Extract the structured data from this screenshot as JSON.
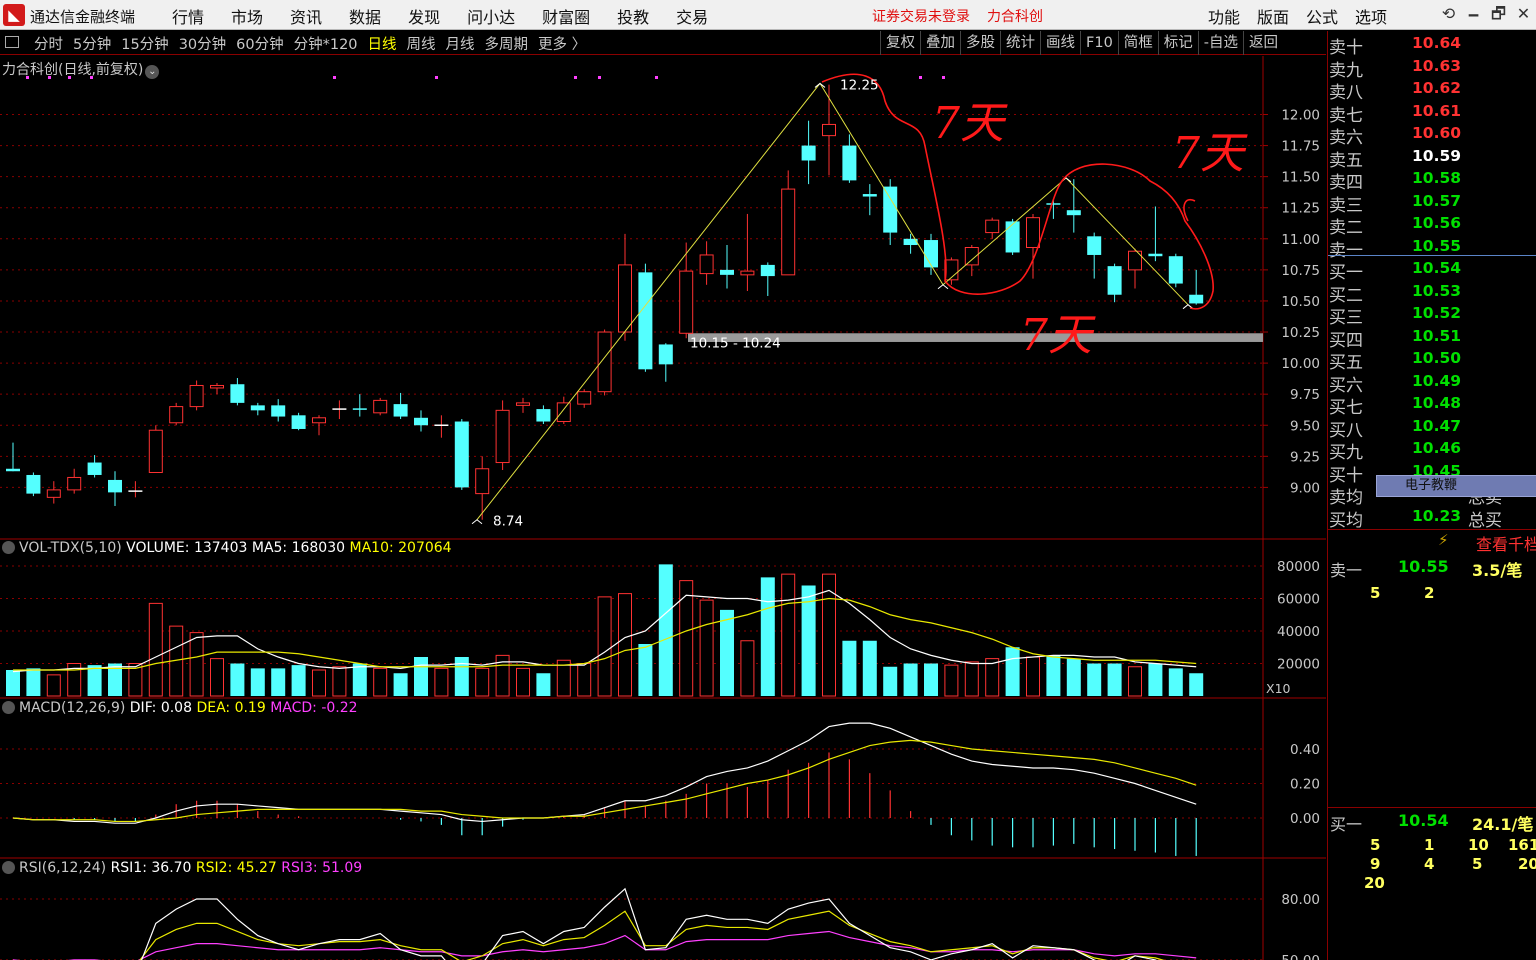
{
  "app": {
    "title": "通达信金融终端",
    "menu": [
      "行情",
      "市场",
      "资讯",
      "数据",
      "发现",
      "问小达",
      "财富圈",
      "投教",
      "交易"
    ],
    "status_text": "证券交易未登录",
    "stock_name": "力合科创",
    "right_menu": [
      "功能",
      "版面",
      "公式",
      "选项"
    ],
    "window_controls": [
      "⟲",
      "🗕",
      "🗗",
      "✕"
    ]
  },
  "toolbar": {
    "periods": [
      "分时",
      "5分钟",
      "15分钟",
      "30分钟",
      "60分钟",
      "分钟*120",
      "日线",
      "周线",
      "月线",
      "多周期",
      "更多 〉"
    ],
    "active_period": "日线",
    "tools": [
      "复权",
      "叠加",
      "多股",
      "统计",
      "画线",
      "F10",
      "简框",
      "标记",
      "-自选",
      "返回"
    ]
  },
  "main_chart": {
    "caption": "力合科创(日线,前复权)",
    "y_ticks": [
      "12.00",
      "11.75",
      "11.50",
      "11.25",
      "11.00",
      "10.75",
      "10.50",
      "10.25",
      "10.00",
      "9.75",
      "9.50",
      "9.25",
      "9.00"
    ],
    "low_label": "8.74",
    "high_label": "12.25",
    "range_label": "10.15 - 10.24",
    "annotations": [
      "7天",
      "7天",
      "7天"
    ],
    "colors": {
      "up": "#ff3232",
      "down": "#54ffff",
      "ma": "#ffff00",
      "grid": "#8a0000",
      "draw_line": "#e0e040",
      "hand_drawn": "#ff1a1a",
      "support_band": "#9a9a9a"
    }
  },
  "candles": [
    {
      "o": 9.15,
      "c": 9.13,
      "h": 9.36,
      "l": 9.13
    },
    {
      "o": 9.1,
      "c": 8.95,
      "h": 9.12,
      "l": 8.93
    },
    {
      "o": 8.92,
      "c": 8.98,
      "h": 9.05,
      "l": 8.87
    },
    {
      "o": 8.98,
      "c": 9.08,
      "h": 9.15,
      "l": 8.95
    },
    {
      "o": 9.2,
      "c": 9.1,
      "h": 9.26,
      "l": 9.08
    },
    {
      "o": 9.06,
      "c": 8.96,
      "h": 9.13,
      "l": 8.85
    },
    {
      "o": 8.96,
      "c": 8.97,
      "h": 9.05,
      "l": 8.92
    },
    {
      "o": 9.12,
      "c": 9.46,
      "h": 9.5,
      "l": 9.12
    },
    {
      "o": 9.52,
      "c": 9.65,
      "h": 9.68,
      "l": 9.5
    },
    {
      "o": 9.65,
      "c": 9.82,
      "h": 9.86,
      "l": 9.62
    },
    {
      "o": 9.8,
      "c": 9.82,
      "h": 9.84,
      "l": 9.75
    },
    {
      "o": 9.83,
      "c": 9.68,
      "h": 9.88,
      "l": 9.66
    },
    {
      "o": 9.66,
      "c": 9.62,
      "h": 9.68,
      "l": 9.58
    },
    {
      "o": 9.66,
      "c": 9.57,
      "h": 9.71,
      "l": 9.53
    },
    {
      "o": 9.58,
      "c": 9.47,
      "h": 9.6,
      "l": 9.46
    },
    {
      "o": 9.52,
      "c": 9.56,
      "h": 9.58,
      "l": 9.42
    },
    {
      "o": 9.63,
      "c": 9.63,
      "h": 9.7,
      "l": 9.55
    },
    {
      "o": 9.63,
      "c": 9.62,
      "h": 9.75,
      "l": 9.57
    },
    {
      "o": 9.6,
      "c": 9.7,
      "h": 9.72,
      "l": 9.58
    },
    {
      "o": 9.67,
      "c": 9.57,
      "h": 9.76,
      "l": 9.55
    },
    {
      "o": 9.56,
      "c": 9.5,
      "h": 9.62,
      "l": 9.45
    },
    {
      "o": 9.49,
      "c": 9.5,
      "h": 9.58,
      "l": 9.4
    },
    {
      "o": 9.53,
      "c": 9.0,
      "h": 9.55,
      "l": 8.98
    },
    {
      "o": 8.95,
      "c": 9.15,
      "h": 9.25,
      "l": 8.74
    },
    {
      "o": 9.2,
      "c": 9.62,
      "h": 9.7,
      "l": 9.14
    },
    {
      "o": 9.66,
      "c": 9.68,
      "h": 9.72,
      "l": 9.6
    },
    {
      "o": 9.63,
      "c": 9.53,
      "h": 9.66,
      "l": 9.51
    },
    {
      "o": 9.53,
      "c": 9.68,
      "h": 9.73,
      "l": 9.51
    },
    {
      "o": 9.67,
      "c": 9.77,
      "h": 9.79,
      "l": 9.64
    },
    {
      "o": 9.77,
      "c": 10.25,
      "h": 10.27,
      "l": 9.74
    },
    {
      "o": 10.25,
      "c": 10.79,
      "h": 11.04,
      "l": 10.18
    },
    {
      "o": 10.73,
      "c": 9.95,
      "h": 10.8,
      "l": 9.93
    },
    {
      "o": 10.15,
      "c": 9.99,
      "h": 10.16,
      "l": 9.85
    },
    {
      "o": 10.24,
      "c": 10.74,
      "h": 10.97,
      "l": 10.2
    },
    {
      "o": 10.72,
      "c": 10.87,
      "h": 10.98,
      "l": 10.63
    },
    {
      "o": 10.75,
      "c": 10.71,
      "h": 10.95,
      "l": 10.6
    },
    {
      "o": 10.71,
      "c": 10.74,
      "h": 11.2,
      "l": 10.58
    },
    {
      "o": 10.79,
      "c": 10.7,
      "h": 10.81,
      "l": 10.54
    },
    {
      "o": 10.71,
      "c": 11.4,
      "h": 11.55,
      "l": 10.71
    },
    {
      "o": 11.75,
      "c": 11.63,
      "h": 11.95,
      "l": 11.44
    },
    {
      "o": 11.83,
      "c": 11.92,
      "h": 12.24,
      "l": 11.51
    },
    {
      "o": 11.75,
      "c": 11.47,
      "h": 11.84,
      "l": 11.45
    },
    {
      "o": 11.36,
      "c": 11.34,
      "h": 11.44,
      "l": 11.19
    },
    {
      "o": 11.42,
      "c": 11.05,
      "h": 11.48,
      "l": 10.95
    },
    {
      "o": 11.0,
      "c": 10.95,
      "h": 11.04,
      "l": 10.88
    },
    {
      "o": 10.99,
      "c": 10.77,
      "h": 11.04,
      "l": 10.71
    },
    {
      "o": 10.67,
      "c": 10.83,
      "h": 10.85,
      "l": 10.63
    },
    {
      "o": 10.79,
      "c": 10.93,
      "h": 10.95,
      "l": 10.7
    },
    {
      "o": 11.05,
      "c": 11.15,
      "h": 11.17,
      "l": 11.0
    },
    {
      "o": 11.14,
      "c": 10.89,
      "h": 11.16,
      "l": 10.87
    },
    {
      "o": 10.93,
      "c": 11.17,
      "h": 11.2,
      "l": 10.68
    },
    {
      "o": 11.28,
      "c": 11.27,
      "h": 11.32,
      "l": 11.16
    },
    {
      "o": 11.23,
      "c": 11.19,
      "h": 11.48,
      "l": 11.05
    },
    {
      "o": 11.02,
      "c": 10.87,
      "h": 11.05,
      "l": 10.68
    },
    {
      "o": 10.78,
      "c": 10.55,
      "h": 10.8,
      "l": 10.49
    },
    {
      "o": 10.75,
      "c": 10.9,
      "h": 10.92,
      "l": 10.6
    },
    {
      "o": 10.88,
      "c": 10.86,
      "h": 11.26,
      "l": 10.82
    },
    {
      "o": 10.86,
      "c": 10.64,
      "h": 10.88,
      "l": 10.61
    },
    {
      "o": 10.55,
      "c": 10.48,
      "h": 10.75,
      "l": 10.47
    }
  ],
  "volume": {
    "label": "VOL-TDX(5,10)",
    "text_vol": "VOLUME: 137403",
    "text_ma5": "MA5: 168030",
    "text_ma10": "MA10: 207064",
    "y_ticks": [
      "80000",
      "60000",
      "40000",
      "20000"
    ],
    "unit": "X10",
    "values": [
      16000,
      17000,
      13000,
      20000,
      19000,
      20000,
      20000,
      57000,
      43000,
      39000,
      23000,
      20000,
      17000,
      17000,
      19000,
      16000,
      18000,
      20000,
      17000,
      14000,
      24000,
      17000,
      24000,
      17000,
      25000,
      17000,
      14000,
      22000,
      20000,
      61000,
      63000,
      32000,
      81000,
      71000,
      59000,
      53000,
      34000,
      73000,
      75000,
      68000,
      75000,
      34000,
      34000,
      18000,
      20000,
      20000,
      19000,
      21000,
      23000,
      30000,
      24000,
      25000,
      23000,
      20000,
      20000,
      18000,
      20000,
      17000,
      14000
    ],
    "ma5": [
      15000,
      16000,
      16000,
      17000,
      17000,
      18000,
      18000,
      24000,
      30000,
      36000,
      37000,
      37000,
      29000,
      24000,
      20000,
      18000,
      17000,
      18000,
      18000,
      17000,
      19000,
      19000,
      20000,
      19000,
      21000,
      21000,
      19000,
      19000,
      19000,
      27000,
      36000,
      40000,
      51000,
      62000,
      61000,
      60000,
      60000,
      58000,
      59000,
      61000,
      65000,
      57000,
      47000,
      36000,
      29000,
      25000,
      22000,
      20000,
      20000,
      23000,
      24000,
      25000,
      25000,
      24000,
      24000,
      21000,
      20000,
      19000,
      18000
    ],
    "ma10": [
      16000,
      16000,
      16000,
      16000,
      17000,
      17000,
      17000,
      20000,
      22000,
      24000,
      27000,
      27000,
      27000,
      27000,
      26000,
      24000,
      22000,
      20000,
      18000,
      18000,
      18000,
      18000,
      18000,
      18000,
      19000,
      19000,
      19000,
      19000,
      20000,
      23000,
      28000,
      30000,
      35000,
      40000,
      44000,
      47000,
      50000,
      54000,
      57000,
      58000,
      60000,
      59000,
      55000,
      50000,
      47000,
      45000,
      42000,
      39000,
      35000,
      30000,
      26000,
      24000,
      23000,
      22000,
      22000,
      22000,
      22000,
      21000,
      20000
    ]
  },
  "macd": {
    "label": "MACD(12,26,9)",
    "text_dif": "DIF: 0.08",
    "text_dea": "DEA: 0.19",
    "text_macd": "MACD: -0.22",
    "y_ticks": [
      "0.40",
      "0.20",
      "0.00"
    ],
    "dif": [
      0.0,
      -0.01,
      -0.01,
      -0.02,
      -0.02,
      -0.03,
      -0.03,
      0.0,
      0.04,
      0.07,
      0.08,
      0.08,
      0.07,
      0.06,
      0.05,
      0.05,
      0.05,
      0.05,
      0.05,
      0.04,
      0.03,
      0.02,
      -0.01,
      -0.02,
      -0.01,
      0.0,
      0.0,
      0.01,
      0.02,
      0.06,
      0.1,
      0.1,
      0.13,
      0.18,
      0.24,
      0.27,
      0.29,
      0.33,
      0.39,
      0.45,
      0.53,
      0.55,
      0.55,
      0.52,
      0.47,
      0.42,
      0.37,
      0.33,
      0.31,
      0.3,
      0.29,
      0.29,
      0.28,
      0.26,
      0.23,
      0.2,
      0.16,
      0.12,
      0.08
    ],
    "dea": [
      0.0,
      -0.01,
      -0.01,
      -0.01,
      -0.01,
      -0.02,
      -0.02,
      -0.01,
      0.0,
      0.02,
      0.03,
      0.04,
      0.05,
      0.05,
      0.05,
      0.05,
      0.05,
      0.05,
      0.05,
      0.05,
      0.04,
      0.04,
      0.02,
      0.01,
      0.0,
      0.0,
      0.0,
      0.01,
      0.01,
      0.03,
      0.05,
      0.07,
      0.09,
      0.11,
      0.14,
      0.17,
      0.2,
      0.22,
      0.25,
      0.29,
      0.34,
      0.38,
      0.42,
      0.44,
      0.45,
      0.44,
      0.42,
      0.4,
      0.39,
      0.38,
      0.37,
      0.36,
      0.35,
      0.34,
      0.32,
      0.29,
      0.26,
      0.23,
      0.19
    ],
    "hist": [
      0.0,
      0.0,
      0.0,
      -0.01,
      -0.01,
      -0.02,
      -0.02,
      0.02,
      0.08,
      0.1,
      0.1,
      0.08,
      0.04,
      0.02,
      0.01,
      0.0,
      0.0,
      0.0,
      0.0,
      -0.01,
      -0.02,
      -0.04,
      -0.1,
      -0.1,
      -0.05,
      -0.01,
      0.0,
      0.01,
      0.02,
      0.06,
      0.1,
      0.07,
      0.1,
      0.14,
      0.2,
      0.2,
      0.18,
      0.22,
      0.28,
      0.32,
      0.38,
      0.34,
      0.26,
      0.16,
      0.04,
      -0.04,
      -0.1,
      -0.13,
      -0.16,
      -0.17,
      -0.17,
      -0.16,
      -0.15,
      -0.17,
      -0.18,
      -0.19,
      -0.2,
      -0.22,
      -0.22
    ]
  },
  "rsi": {
    "label": "RSI(6,12,24)",
    "text_rsi1": "RSI1: 36.70",
    "text_rsi2": "RSI2: 45.27",
    "text_rsi3": "RSI3: 51.09",
    "y_ticks": [
      "80.00",
      "50.00"
    ],
    "rsi1": [
      45,
      38,
      40,
      46,
      48,
      42,
      42,
      68,
      75,
      80,
      80,
      70,
      62,
      58,
      55,
      58,
      60,
      60,
      63,
      55,
      52,
      52,
      40,
      48,
      62,
      64,
      58,
      64,
      66,
      76,
      85,
      55,
      56,
      70,
      72,
      70,
      70,
      68,
      75,
      78,
      80,
      68,
      62,
      56,
      54,
      50,
      53,
      55,
      58,
      51,
      57,
      56,
      55,
      50,
      46,
      52,
      50,
      45,
      37
    ],
    "rsi2": [
      48,
      45,
      46,
      48,
      49,
      47,
      47,
      60,
      65,
      68,
      68,
      64,
      60,
      58,
      57,
      58,
      59,
      59,
      60,
      57,
      55,
      55,
      49,
      52,
      58,
      60,
      57,
      60,
      61,
      67,
      74,
      57,
      57,
      65,
      67,
      66,
      66,
      65,
      70,
      72,
      74,
      67,
      63,
      59,
      57,
      54,
      55,
      56,
      57,
      53,
      56,
      56,
      55,
      51,
      49,
      52,
      51,
      48,
      45
    ],
    "rsi3": [
      50,
      49,
      49,
      50,
      50,
      49,
      49,
      54,
      56,
      58,
      58,
      57,
      56,
      55,
      55,
      55,
      55,
      55,
      56,
      55,
      54,
      54,
      52,
      52,
      54,
      55,
      54,
      55,
      56,
      58,
      62,
      55,
      55,
      59,
      60,
      60,
      60,
      60,
      62,
      63,
      64,
      61,
      59,
      57,
      56,
      54,
      54,
      55,
      55,
      54,
      55,
      55,
      55,
      53,
      52,
      53,
      53,
      52,
      51
    ]
  },
  "quote": {
    "asks": [
      {
        "label": "卖十",
        "price": "10.64"
      },
      {
        "label": "卖九",
        "price": "10.63"
      },
      {
        "label": "卖八",
        "price": "10.62"
      },
      {
        "label": "卖七",
        "price": "10.61"
      },
      {
        "label": "卖六",
        "price": "10.60"
      },
      {
        "label": "卖五",
        "price": "10.59"
      },
      {
        "label": "卖四",
        "price": "10.58"
      },
      {
        "label": "卖三",
        "price": "10.57"
      },
      {
        "label": "卖二",
        "price": "10.56"
      },
      {
        "label": "卖一",
        "price": "10.55"
      }
    ],
    "bids": [
      {
        "label": "买一",
        "price": "10.54"
      },
      {
        "label": "买二",
        "price": "10.53"
      },
      {
        "label": "买三",
        "price": "10.52"
      },
      {
        "label": "买四",
        "price": "10.51"
      },
      {
        "label": "买五",
        "price": "10.50"
      },
      {
        "label": "买六",
        "price": "10.49"
      },
      {
        "label": "买七",
        "price": "10.48"
      },
      {
        "label": "买八",
        "price": "10.47"
      },
      {
        "label": "买九",
        "price": "10.46"
      },
      {
        "label": "买十",
        "price": "10.45"
      }
    ],
    "avg_sell_label": "卖均",
    "avg_buy_label": "买均",
    "avg_buy_price": "10.23",
    "total_sell": "总卖",
    "total_buy": "总买",
    "edu_button": "电子教鞭",
    "view_more": "查看千档",
    "ask1_label": "卖一",
    "ask1_price": "10.55",
    "ask1_vol": "3.5/笔",
    "ask1_detail": [
      "5",
      "2"
    ],
    "bid1_label": "买一",
    "bid1_price": "10.54",
    "bid1_vol": "24.1/笔",
    "bid1_detail_row1": [
      "5",
      "1",
      "10",
      "161"
    ],
    "bid1_detail_row2": [
      "9",
      "4",
      "5",
      "20"
    ],
    "bid1_detail_row3": [
      "20"
    ]
  }
}
